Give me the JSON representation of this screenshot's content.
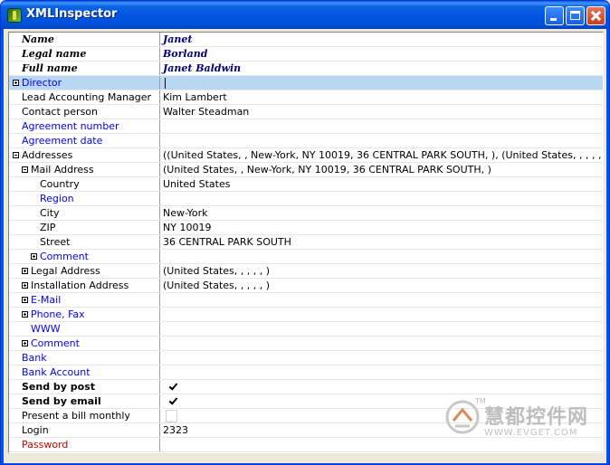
{
  "window": {
    "title": "XMLInspector"
  },
  "rows": {
    "name": {
      "label": "Name",
      "value": "Janet"
    },
    "legal_name": {
      "label": "Legal name",
      "value": "Borland"
    },
    "full_name": {
      "label": "Full name",
      "value": "Janet Baldwin"
    },
    "director": {
      "label": "Director",
      "value": ""
    },
    "lead_accounting_manager": {
      "label": "Lead Accounting Manager",
      "value": "Kim Lambert"
    },
    "contact_person": {
      "label": "Contact person",
      "value": "Walter Steadman"
    },
    "agreement_number": {
      "label": "Agreement number",
      "value": ""
    },
    "agreement_date": {
      "label": "Agreement date",
      "value": ""
    },
    "addresses": {
      "label": "Addresses",
      "value": "((United States, , New-York, NY 10019, 36 CENTRAL PARK SOUTH, ), (United States, , , , , ), (United"
    },
    "mail_address": {
      "label": "Mail Address",
      "value": "(United States, , New-York, NY 10019, 36 CENTRAL PARK SOUTH, )"
    },
    "country": {
      "label": "Country",
      "value": "United States"
    },
    "region": {
      "label": "Region",
      "value": ""
    },
    "city": {
      "label": "City",
      "value": "New-York"
    },
    "zip": {
      "label": "ZIP",
      "value": "NY 10019"
    },
    "street": {
      "label": "Street",
      "value": "36 CENTRAL PARK SOUTH"
    },
    "mail_comment": {
      "label": "Comment",
      "value": ""
    },
    "legal_address": {
      "label": "Legal Address",
      "value": "(United States, , , , , )"
    },
    "installation_address": {
      "label": "Installation Address",
      "value": "(United States, , , , , )"
    },
    "email": {
      "label": "E-Mail",
      "value": ""
    },
    "phone_fax": {
      "label": "Phone, Fax",
      "value": ""
    },
    "www": {
      "label": "WWW",
      "value": ""
    },
    "comment": {
      "label": "Comment",
      "value": ""
    },
    "bank": {
      "label": "Bank",
      "value": ""
    },
    "bank_account": {
      "label": "Bank Account",
      "value": ""
    },
    "send_by_post": {
      "label": "Send by post",
      "checked": true
    },
    "send_by_email": {
      "label": "Send by email",
      "checked": true
    },
    "bill_monthly": {
      "label": "Present a bill monthly",
      "checked": false
    },
    "login": {
      "label": "Login",
      "value": "2323"
    },
    "password": {
      "label": "Password",
      "value": ""
    }
  },
  "watermark": {
    "text": "慧都控件网",
    "url": "WWW.EVGET.COM",
    "tm": "TM"
  }
}
